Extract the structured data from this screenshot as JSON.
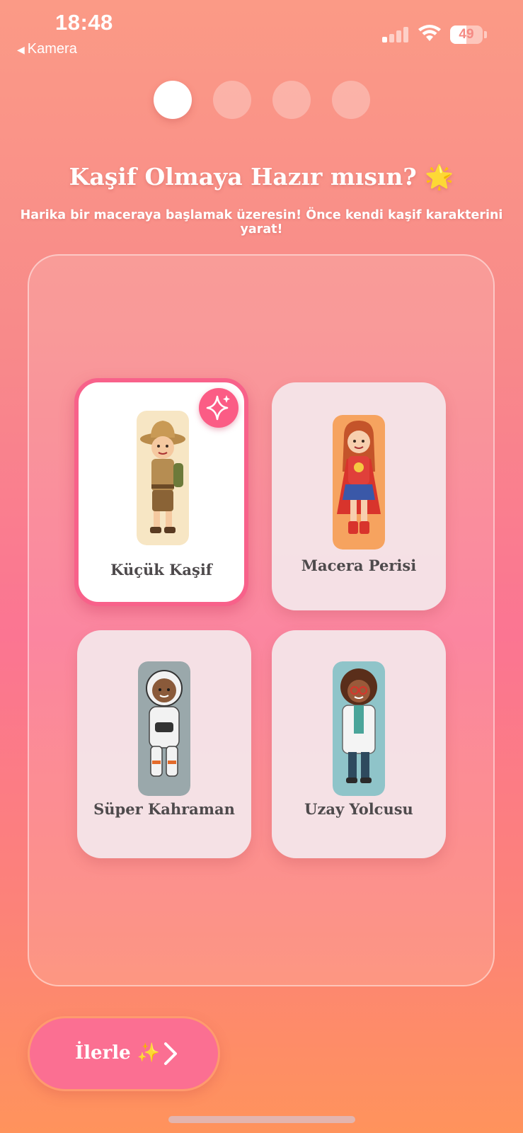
{
  "status_bar": {
    "time": "18:48",
    "back_label": "Kamera",
    "battery_percent": "49",
    "battery_level": 0.49,
    "signal_bars_active": 1,
    "icons": [
      "signal-icon",
      "wifi-icon",
      "battery-icon"
    ]
  },
  "steps": {
    "total": 4,
    "current": 1
  },
  "header": {
    "title": "Kaşif Olmaya Hazır mısın? 🌟",
    "subtitle": "Harika bir maceraya başlamak üzeresin! Önce kendi kaşif karakterini yarat!"
  },
  "characters": [
    {
      "label": "Küçük Kaşif",
      "selected": true,
      "icon": "explorer-icon",
      "thumb_color": "#f7e6c4"
    },
    {
      "label": "Macera Perisi",
      "selected": false,
      "icon": "superhero-girl-icon",
      "thumb_color": "#f6a35f"
    },
    {
      "label": "Süper Kahraman",
      "selected": false,
      "icon": "astronaut-icon",
      "thumb_color": "#9aa8ab"
    },
    {
      "label": "Uzay Yolcusu",
      "selected": false,
      "icon": "scientist-icon",
      "thumb_color": "#8fc4c9"
    }
  ],
  "next_button": {
    "label": "İlerle ✨"
  },
  "colors": {
    "accent": "#fb5c85",
    "button": "#fb6f92",
    "card": "#f5e4e8",
    "label_text": "#4e4a4c"
  }
}
